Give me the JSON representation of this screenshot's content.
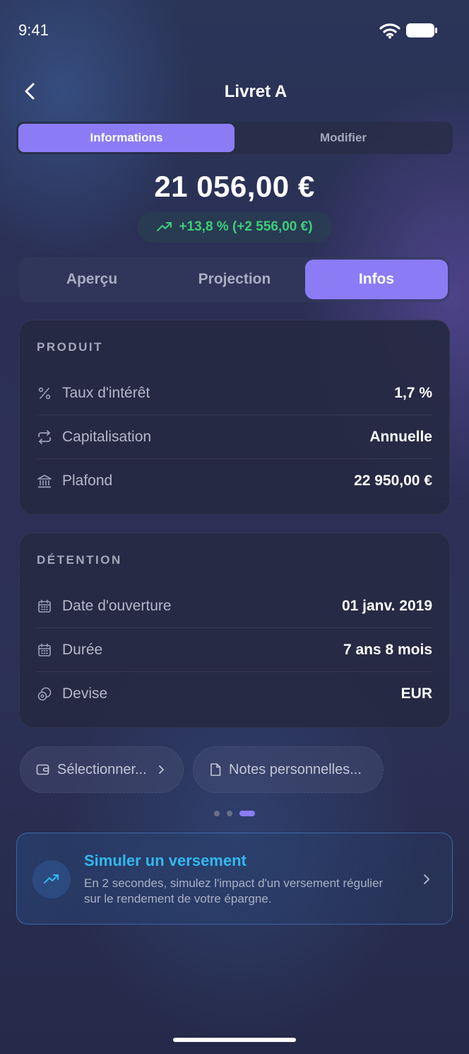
{
  "status_bar": {
    "time": "9:41"
  },
  "header": {
    "title": "Livret A",
    "back_icon": "chevron-left-icon"
  },
  "segment": {
    "active": "Informations",
    "inactive": "Modifier"
  },
  "balance": {
    "amount": "21 056,00 €",
    "performance": "+13,8 % (+2 556,00 €)",
    "performance_color": "#3ccf7a"
  },
  "tabs": [
    {
      "label": "Aperçu"
    },
    {
      "label": "Projection"
    },
    {
      "label": "Infos"
    }
  ],
  "product_card": {
    "title": "PRODUIT",
    "rows": [
      {
        "icon": "percent-icon",
        "label": "Taux d'intérêt",
        "value": "1,7 %"
      },
      {
        "icon": "repeat-icon",
        "label": "Capitalisation",
        "value": "Annuelle"
      },
      {
        "icon": "bank-icon",
        "label": "Plafond",
        "value": "22 950,00 €"
      }
    ]
  },
  "holding_card": {
    "title": "DÉTENTION",
    "rows": [
      {
        "icon": "calendar-icon",
        "label": "Date d'ouverture",
        "value": "01 janv. 2019"
      },
      {
        "icon": "calendar-icon",
        "label": "Durée",
        "value": "7 ans 8 mois"
      },
      {
        "icon": "currency-icon",
        "label": "Devise",
        "value": "EUR"
      }
    ]
  },
  "chips": {
    "select_label": "Sélectionner...",
    "notes_label": "Notes personnelles..."
  },
  "pager": {
    "count": 3,
    "active_index": 2
  },
  "promo": {
    "title": "Simuler un versement",
    "text": "En 2 secondes, simulez l'impact d'un versement régulier sur le rendement de votre épargne."
  },
  "colors": {
    "accent": "#8b7cf6",
    "promo_title": "#33b8f0"
  }
}
